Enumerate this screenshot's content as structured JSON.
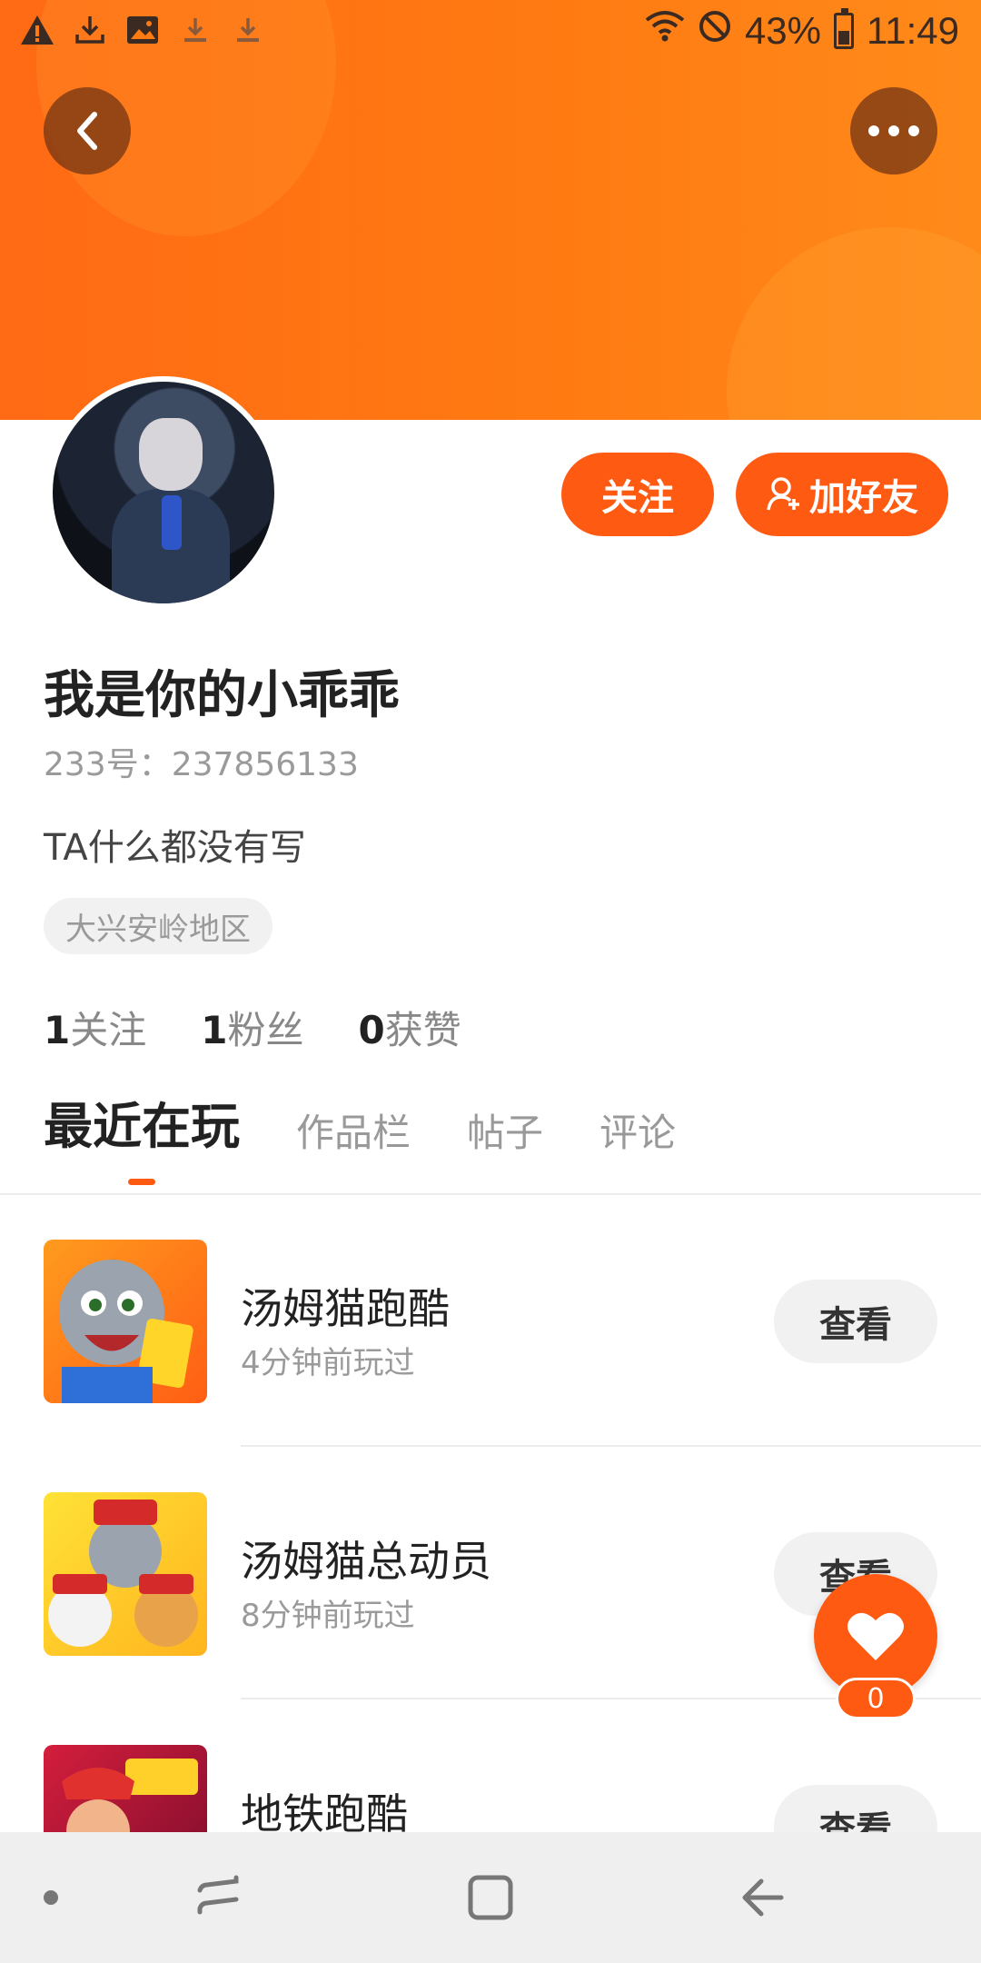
{
  "status_bar": {
    "battery": "43%",
    "time": "11:49",
    "icons": [
      "warning-icon",
      "download-icon",
      "image-icon",
      "download-icon",
      "download-icon",
      "wifi-icon",
      "no-disturb-icon",
      "battery-icon"
    ]
  },
  "header": {
    "back_icon": "chevron-left-icon",
    "more_icon": "more-horizontal-icon"
  },
  "profile": {
    "follow_label": "关注",
    "add_friend_label": "加好友",
    "username": "我是你的小乖乖",
    "user_id": "233号：237856133",
    "bio": "TA什么都没有写",
    "region": "大兴安岭地区"
  },
  "stats": [
    {
      "num": "1",
      "label": "关注"
    },
    {
      "num": "1",
      "label": "粉丝"
    },
    {
      "num": "0",
      "label": "获赞"
    }
  ],
  "tabs": [
    {
      "label": "最近在玩",
      "active": true
    },
    {
      "label": "作品栏",
      "active": false
    },
    {
      "label": "帖子",
      "active": false
    },
    {
      "label": "评论",
      "active": false
    }
  ],
  "games": [
    {
      "name": "汤姆猫跑酷",
      "time": "4分钟前玩过",
      "button": "查看"
    },
    {
      "name": "汤姆猫总动员",
      "time": "8分钟前玩过",
      "button": "查看"
    },
    {
      "name": "地铁跑酷",
      "time": "",
      "button": "查看"
    }
  ],
  "like_fab": {
    "count": "0",
    "icon": "heart-icon"
  },
  "colors": {
    "accent": "#ff5a12",
    "banner": "#ff7a12"
  }
}
